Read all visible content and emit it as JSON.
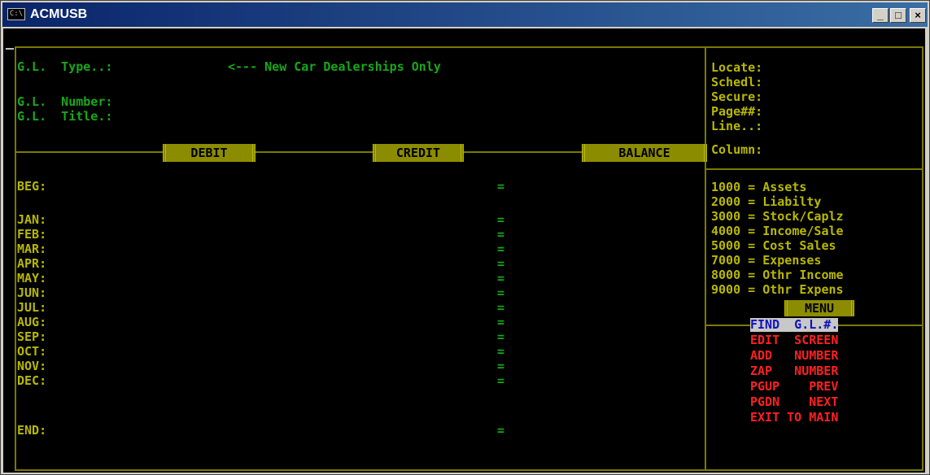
{
  "window": {
    "title": "ACMUSB",
    "icon_label": "C:\\",
    "min_glyph": "_",
    "max_glyph": "□",
    "close_glyph": "×"
  },
  "header": {
    "type_label": "G.L.  Type..:",
    "type_note": "<--- New Car Dealerships Only",
    "number_label": "G.L.  Number:",
    "title_label": "G.L.  Title.:"
  },
  "columns": [
    "DEBIT",
    "CREDIT",
    "BALANCE"
  ],
  "right_info": [
    "Locate:",
    "Schedl:",
    "Secure:",
    "Page##:",
    "Line..:",
    "Column:"
  ],
  "periods": [
    "BEG:",
    "JAN:",
    "FEB:",
    "MAR:",
    "APR:",
    "MAY:",
    "JUN:",
    "JUL:",
    "AUG:",
    "SEP:",
    "OCT:",
    "NOV:",
    "DEC:",
    "END:"
  ],
  "equals": "=",
  "account_ranges": [
    "1000 = Assets",
    "2000 = Liabilty",
    "3000 = Stock/Caplz",
    "4000 = Income/Sale",
    "5000 = Cost Sales",
    "7000 = Expenses",
    "8000 = Othr Income",
    "9000 = Othr Expens"
  ],
  "menu": {
    "title": "MENU",
    "items": [
      "FIND  G.L.#.",
      "EDIT  SCREEN",
      "ADD   NUMBER",
      "ZAP   NUMBER",
      "PGUP    PREV",
      "PGDN    NEXT",
      "EXIT TO MAIN"
    ]
  }
}
